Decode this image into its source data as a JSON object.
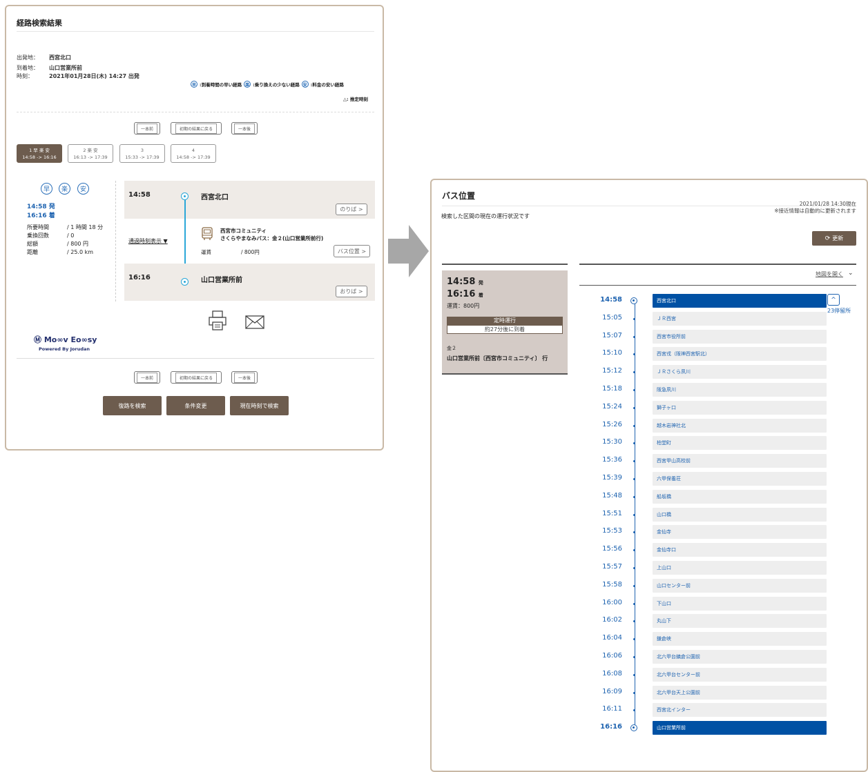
{
  "left": {
    "title": "経路検索結果",
    "departure_label": "出発地：",
    "departure_value": "西宮北口",
    "arrival_label": "到着地：",
    "arrival_value": "山口営業所前",
    "time_label": "時刻：",
    "time_value": "2021年01月28日(木) 14:27 出発",
    "legend_fast_icon": "早",
    "legend_fast": ":到着時間の早い経路",
    "legend_easy_icon": "楽",
    "legend_easy": ":乗り換えの少ない経路",
    "legend_cheap_icon": "安",
    "legend_cheap": ":料金の安い経路",
    "legend_estimate": "△: 推定時刻",
    "nav": {
      "prev": "一本前",
      "reset": "初期の結果に戻る",
      "next": "一本後"
    },
    "tabs": [
      {
        "num": "1 早 楽 安",
        "time": "14:58 -> 16:16"
      },
      {
        "num": "2 楽 安",
        "time": "16:13 -> 17:39"
      },
      {
        "num": "3",
        "time": "15:33 -> 17:39"
      },
      {
        "num": "4",
        "time": "14:58 -> 17:39"
      }
    ],
    "summary": {
      "badge_fast": "早",
      "badge_easy": "楽",
      "badge_cheap": "安",
      "dep": "14:58 発",
      "arr": "16:16 着",
      "rows": [
        {
          "k": "所要時間",
          "v": "/ 1 時間 18 分"
        },
        {
          "k": "乗換回数",
          "v": "/ 0"
        },
        {
          "k": "総額",
          "v": "/ 800 円"
        },
        {
          "k": "距離",
          "v": "/ 25.0 km"
        }
      ]
    },
    "route": {
      "dep_time": "14:58",
      "dep_stop": "西宮北口",
      "board_btn": "のりば >",
      "passing_toggle": "通過時刻表示 ▼",
      "operator": "西宮市コミュニティ",
      "line": "さくらやまなみバス：金２(山口営業所前行)",
      "fare_label": "運賃",
      "fare_value": "/ 800円",
      "bus_pos_btn": "バス位置 >",
      "arr_time": "16:16",
      "arr_stop": "山口営業所前",
      "alight_btn": "おりば >"
    },
    "logo": {
      "name": "Ⓜ Mo∞v Eo∞sy",
      "sub": "Powered By Jorudan"
    },
    "actions": {
      "return": "復路を検索",
      "change": "条件変更",
      "now": "現在時刻で検索"
    },
    "icons": [
      "printer-icon",
      "mail-icon",
      "bus-icon",
      "arrow-right-icon"
    ]
  },
  "right": {
    "title": "バス位置",
    "updated": "2021/01/28 14:30現在",
    "note": "※接近情報は自動的に更新されます",
    "desc": "検索した区間の現在の運行状況です",
    "refresh": "更新",
    "map_link": "地図を開く",
    "card": {
      "dep_time": "14:58",
      "dep_suffix": "発",
      "arr_time": "16:16",
      "arr_suffix": "着",
      "fare": "運賃：800円",
      "status": "定時運行",
      "arrive_info": "約27分後に到着",
      "line_code": "金２",
      "line_name": "山口営業所前〔西宮市コミュニティ〕 行"
    },
    "stops_count": "23停留所",
    "stops": [
      {
        "time": "14:58",
        "name": "西宮北口"
      },
      {
        "time": "15:05",
        "name": "ＪＲ西宮"
      },
      {
        "time": "15:07",
        "name": "西宮市役所前"
      },
      {
        "time": "15:10",
        "name": "西宮戎（阪神西宮駅北）"
      },
      {
        "time": "15:12",
        "name": "ＪＲさくら夙川"
      },
      {
        "time": "15:18",
        "name": "阪急夙川"
      },
      {
        "time": "15:24",
        "name": "獅子ヶ口"
      },
      {
        "time": "15:26",
        "name": "越木岩神社北"
      },
      {
        "time": "15:30",
        "name": "柏堂町"
      },
      {
        "time": "15:36",
        "name": "西宮甲山高校前"
      },
      {
        "time": "15:39",
        "name": "六甲保養荘"
      },
      {
        "time": "15:48",
        "name": "船坂橋"
      },
      {
        "time": "15:51",
        "name": "山口橋"
      },
      {
        "time": "15:53",
        "name": "金仙寺"
      },
      {
        "time": "15:56",
        "name": "金仙寺口"
      },
      {
        "time": "15:57",
        "name": "上山口"
      },
      {
        "time": "15:58",
        "name": "山口センター前"
      },
      {
        "time": "16:00",
        "name": "下山口"
      },
      {
        "time": "16:02",
        "name": "丸山下"
      },
      {
        "time": "16:04",
        "name": "鎌倉峡"
      },
      {
        "time": "16:06",
        "name": "北六甲台鎮倉公園前"
      },
      {
        "time": "16:08",
        "name": "北六甲台センター前"
      },
      {
        "time": "16:09",
        "name": "北六甲台天上公園前"
      },
      {
        "time": "16:11",
        "name": "西宮北インター"
      },
      {
        "time": "16:16",
        "name": "山口営業所前"
      }
    ]
  }
}
